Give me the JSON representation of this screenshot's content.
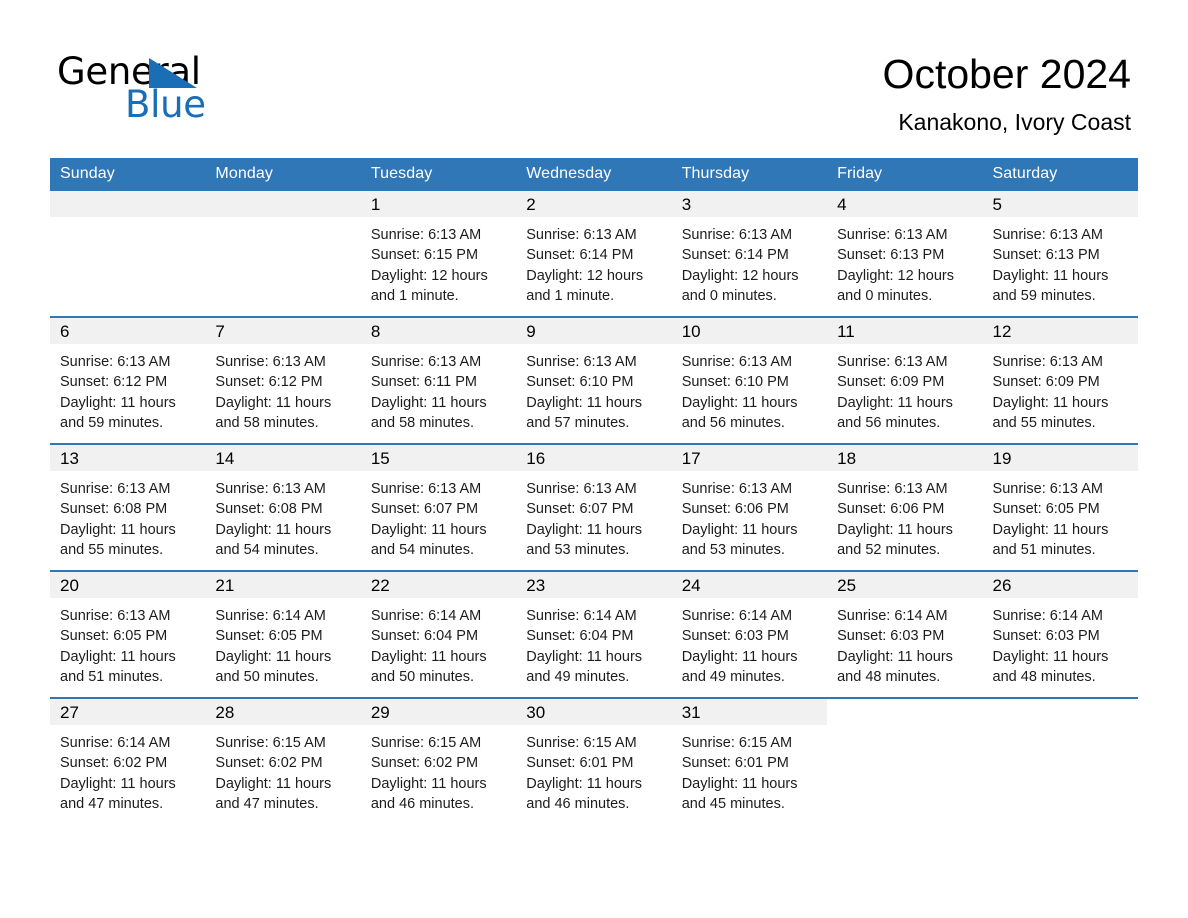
{
  "brand": {
    "word_one": "General",
    "word_two": "Blue",
    "triangle_icon": "triangle-icon",
    "accent_color": "#1a6eb5"
  },
  "header": {
    "month_title": "October 2024",
    "location": "Kanakono, Ivory Coast"
  },
  "theme": {
    "header_blue": "#2f77b6",
    "daynum_band": "#f1f1f1",
    "text": "#000000"
  },
  "calendar": {
    "weekday_headers": [
      "Sunday",
      "Monday",
      "Tuesday",
      "Wednesday",
      "Thursday",
      "Friday",
      "Saturday"
    ],
    "weeks": [
      [
        {
          "day": "",
          "blank": true
        },
        {
          "day": "",
          "blank": true
        },
        {
          "day": "1",
          "sunrise": "Sunrise: 6:13 AM",
          "sunset": "Sunset: 6:15 PM",
          "daylight_line1": "Daylight: 12 hours",
          "daylight_line2": "and 1 minute."
        },
        {
          "day": "2",
          "sunrise": "Sunrise: 6:13 AM",
          "sunset": "Sunset: 6:14 PM",
          "daylight_line1": "Daylight: 12 hours",
          "daylight_line2": "and 1 minute."
        },
        {
          "day": "3",
          "sunrise": "Sunrise: 6:13 AM",
          "sunset": "Sunset: 6:14 PM",
          "daylight_line1": "Daylight: 12 hours",
          "daylight_line2": "and 0 minutes."
        },
        {
          "day": "4",
          "sunrise": "Sunrise: 6:13 AM",
          "sunset": "Sunset: 6:13 PM",
          "daylight_line1": "Daylight: 12 hours",
          "daylight_line2": "and 0 minutes."
        },
        {
          "day": "5",
          "sunrise": "Sunrise: 6:13 AM",
          "sunset": "Sunset: 6:13 PM",
          "daylight_line1": "Daylight: 11 hours",
          "daylight_line2": "and 59 minutes."
        }
      ],
      [
        {
          "day": "6",
          "sunrise": "Sunrise: 6:13 AM",
          "sunset": "Sunset: 6:12 PM",
          "daylight_line1": "Daylight: 11 hours",
          "daylight_line2": "and 59 minutes."
        },
        {
          "day": "7",
          "sunrise": "Sunrise: 6:13 AM",
          "sunset": "Sunset: 6:12 PM",
          "daylight_line1": "Daylight: 11 hours",
          "daylight_line2": "and 58 minutes."
        },
        {
          "day": "8",
          "sunrise": "Sunrise: 6:13 AM",
          "sunset": "Sunset: 6:11 PM",
          "daylight_line1": "Daylight: 11 hours",
          "daylight_line2": "and 58 minutes."
        },
        {
          "day": "9",
          "sunrise": "Sunrise: 6:13 AM",
          "sunset": "Sunset: 6:10 PM",
          "daylight_line1": "Daylight: 11 hours",
          "daylight_line2": "and 57 minutes."
        },
        {
          "day": "10",
          "sunrise": "Sunrise: 6:13 AM",
          "sunset": "Sunset: 6:10 PM",
          "daylight_line1": "Daylight: 11 hours",
          "daylight_line2": "and 56 minutes."
        },
        {
          "day": "11",
          "sunrise": "Sunrise: 6:13 AM",
          "sunset": "Sunset: 6:09 PM",
          "daylight_line1": "Daylight: 11 hours",
          "daylight_line2": "and 56 minutes."
        },
        {
          "day": "12",
          "sunrise": "Sunrise: 6:13 AM",
          "sunset": "Sunset: 6:09 PM",
          "daylight_line1": "Daylight: 11 hours",
          "daylight_line2": "and 55 minutes."
        }
      ],
      [
        {
          "day": "13",
          "sunrise": "Sunrise: 6:13 AM",
          "sunset": "Sunset: 6:08 PM",
          "daylight_line1": "Daylight: 11 hours",
          "daylight_line2": "and 55 minutes."
        },
        {
          "day": "14",
          "sunrise": "Sunrise: 6:13 AM",
          "sunset": "Sunset: 6:08 PM",
          "daylight_line1": "Daylight: 11 hours",
          "daylight_line2": "and 54 minutes."
        },
        {
          "day": "15",
          "sunrise": "Sunrise: 6:13 AM",
          "sunset": "Sunset: 6:07 PM",
          "daylight_line1": "Daylight: 11 hours",
          "daylight_line2": "and 54 minutes."
        },
        {
          "day": "16",
          "sunrise": "Sunrise: 6:13 AM",
          "sunset": "Sunset: 6:07 PM",
          "daylight_line1": "Daylight: 11 hours",
          "daylight_line2": "and 53 minutes."
        },
        {
          "day": "17",
          "sunrise": "Sunrise: 6:13 AM",
          "sunset": "Sunset: 6:06 PM",
          "daylight_line1": "Daylight: 11 hours",
          "daylight_line2": "and 53 minutes."
        },
        {
          "day": "18",
          "sunrise": "Sunrise: 6:13 AM",
          "sunset": "Sunset: 6:06 PM",
          "daylight_line1": "Daylight: 11 hours",
          "daylight_line2": "and 52 minutes."
        },
        {
          "day": "19",
          "sunrise": "Sunrise: 6:13 AM",
          "sunset": "Sunset: 6:05 PM",
          "daylight_line1": "Daylight: 11 hours",
          "daylight_line2": "and 51 minutes."
        }
      ],
      [
        {
          "day": "20",
          "sunrise": "Sunrise: 6:13 AM",
          "sunset": "Sunset: 6:05 PM",
          "daylight_line1": "Daylight: 11 hours",
          "daylight_line2": "and 51 minutes."
        },
        {
          "day": "21",
          "sunrise": "Sunrise: 6:14 AM",
          "sunset": "Sunset: 6:05 PM",
          "daylight_line1": "Daylight: 11 hours",
          "daylight_line2": "and 50 minutes."
        },
        {
          "day": "22",
          "sunrise": "Sunrise: 6:14 AM",
          "sunset": "Sunset: 6:04 PM",
          "daylight_line1": "Daylight: 11 hours",
          "daylight_line2": "and 50 minutes."
        },
        {
          "day": "23",
          "sunrise": "Sunrise: 6:14 AM",
          "sunset": "Sunset: 6:04 PM",
          "daylight_line1": "Daylight: 11 hours",
          "daylight_line2": "and 49 minutes."
        },
        {
          "day": "24",
          "sunrise": "Sunrise: 6:14 AM",
          "sunset": "Sunset: 6:03 PM",
          "daylight_line1": "Daylight: 11 hours",
          "daylight_line2": "and 49 minutes."
        },
        {
          "day": "25",
          "sunrise": "Sunrise: 6:14 AM",
          "sunset": "Sunset: 6:03 PM",
          "daylight_line1": "Daylight: 11 hours",
          "daylight_line2": "and 48 minutes."
        },
        {
          "day": "26",
          "sunrise": "Sunrise: 6:14 AM",
          "sunset": "Sunset: 6:03 PM",
          "daylight_line1": "Daylight: 11 hours",
          "daylight_line2": "and 48 minutes."
        }
      ],
      [
        {
          "day": "27",
          "sunrise": "Sunrise: 6:14 AM",
          "sunset": "Sunset: 6:02 PM",
          "daylight_line1": "Daylight: 11 hours",
          "daylight_line2": "and 47 minutes."
        },
        {
          "day": "28",
          "sunrise": "Sunrise: 6:15 AM",
          "sunset": "Sunset: 6:02 PM",
          "daylight_line1": "Daylight: 11 hours",
          "daylight_line2": "and 47 minutes."
        },
        {
          "day": "29",
          "sunrise": "Sunrise: 6:15 AM",
          "sunset": "Sunset: 6:02 PM",
          "daylight_line1": "Daylight: 11 hours",
          "daylight_line2": "and 46 minutes."
        },
        {
          "day": "30",
          "sunrise": "Sunrise: 6:15 AM",
          "sunset": "Sunset: 6:01 PM",
          "daylight_line1": "Daylight: 11 hours",
          "daylight_line2": "and 46 minutes."
        },
        {
          "day": "31",
          "sunrise": "Sunrise: 6:15 AM",
          "sunset": "Sunset: 6:01 PM",
          "daylight_line1": "Daylight: 11 hours",
          "daylight_line2": "and 45 minutes."
        },
        {
          "day": "",
          "blank": true
        },
        {
          "day": "",
          "blank": true
        }
      ]
    ]
  }
}
